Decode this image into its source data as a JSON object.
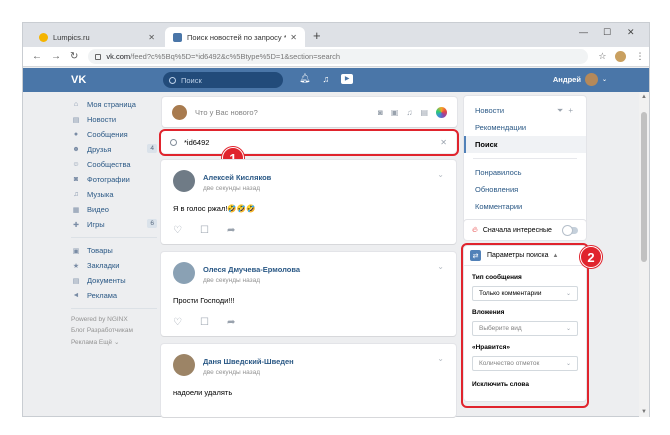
{
  "browser": {
    "tabs": [
      {
        "title": "Lumpics.ru",
        "favicon_color": "#f5b400"
      },
      {
        "title": "Поиск новостей по запросу *id",
        "favicon_color": "#4a76a8"
      }
    ],
    "new_tab": "+",
    "url_host": "vk.com",
    "url_rest": "/feed?c%5Bq%5D=*id6492&c%5Btype%5D=1&section=search"
  },
  "vk_header": {
    "logo": "VK",
    "search_placeholder": "Поиск",
    "user_name": "Андрей"
  },
  "left_menu": {
    "items": [
      {
        "label": "Моя страница",
        "icon": "⌂"
      },
      {
        "label": "Новости",
        "icon": "▤"
      },
      {
        "label": "Сообщения",
        "icon": "●"
      },
      {
        "label": "Друзья",
        "icon": "☻",
        "count": "4"
      },
      {
        "label": "Сообщества",
        "icon": "☺"
      },
      {
        "label": "Фотографии",
        "icon": "◙"
      },
      {
        "label": "Музыка",
        "icon": "♫"
      },
      {
        "label": "Видео",
        "icon": "▦"
      },
      {
        "label": "Игры",
        "icon": "✚",
        "count": "6"
      }
    ],
    "items2": [
      {
        "label": "Товары",
        "icon": "▣"
      },
      {
        "label": "Закладки",
        "icon": "★"
      },
      {
        "label": "Документы",
        "icon": "▤"
      },
      {
        "label": "Реклама",
        "icon": "◄"
      }
    ],
    "powered": "Powered by NGINX",
    "footer1": "Блог   Разработчикам",
    "footer2": "Реклама   Ещё ⌄"
  },
  "feed": {
    "new_post_placeholder": "Что у Вас нового?",
    "search_value": "*id6492",
    "posts": [
      {
        "author": "Алексей Кисляков",
        "time": "две секунды назад",
        "text": "Я в голос ржал!🤣🤣🤣",
        "avatar_color": "#6f7b86"
      },
      {
        "author": "Олеся Дмучева-Ермолова",
        "time": "две секунды назад",
        "text": "Прости Господи!!!",
        "avatar_color": "#8aa1b4"
      },
      {
        "author": "Даня Шведский-Шведен",
        "time": "две секунды назад",
        "text": "надоели удалять",
        "avatar_color": "#9c8466"
      }
    ]
  },
  "right_nav": {
    "items_top": [
      "Новости",
      "Рекомендации",
      "Поиск"
    ],
    "items_bottom": [
      "Понравилось",
      "Обновления",
      "Комментарии"
    ],
    "toggle_label": "Сначала интересные"
  },
  "search_params": {
    "title": "Параметры поиска",
    "label_type": "Тип сообщения",
    "type_value": "Только комментарии",
    "label_attach": "Вложения",
    "attach_placeholder": "Выберите вид",
    "label_likes": "«Нравится»",
    "likes_placeholder": "Количество отметок",
    "label_exclude": "Исключить слова"
  },
  "annotations": {
    "badge1": "1",
    "badge2": "2",
    "color": "#e0242d"
  }
}
